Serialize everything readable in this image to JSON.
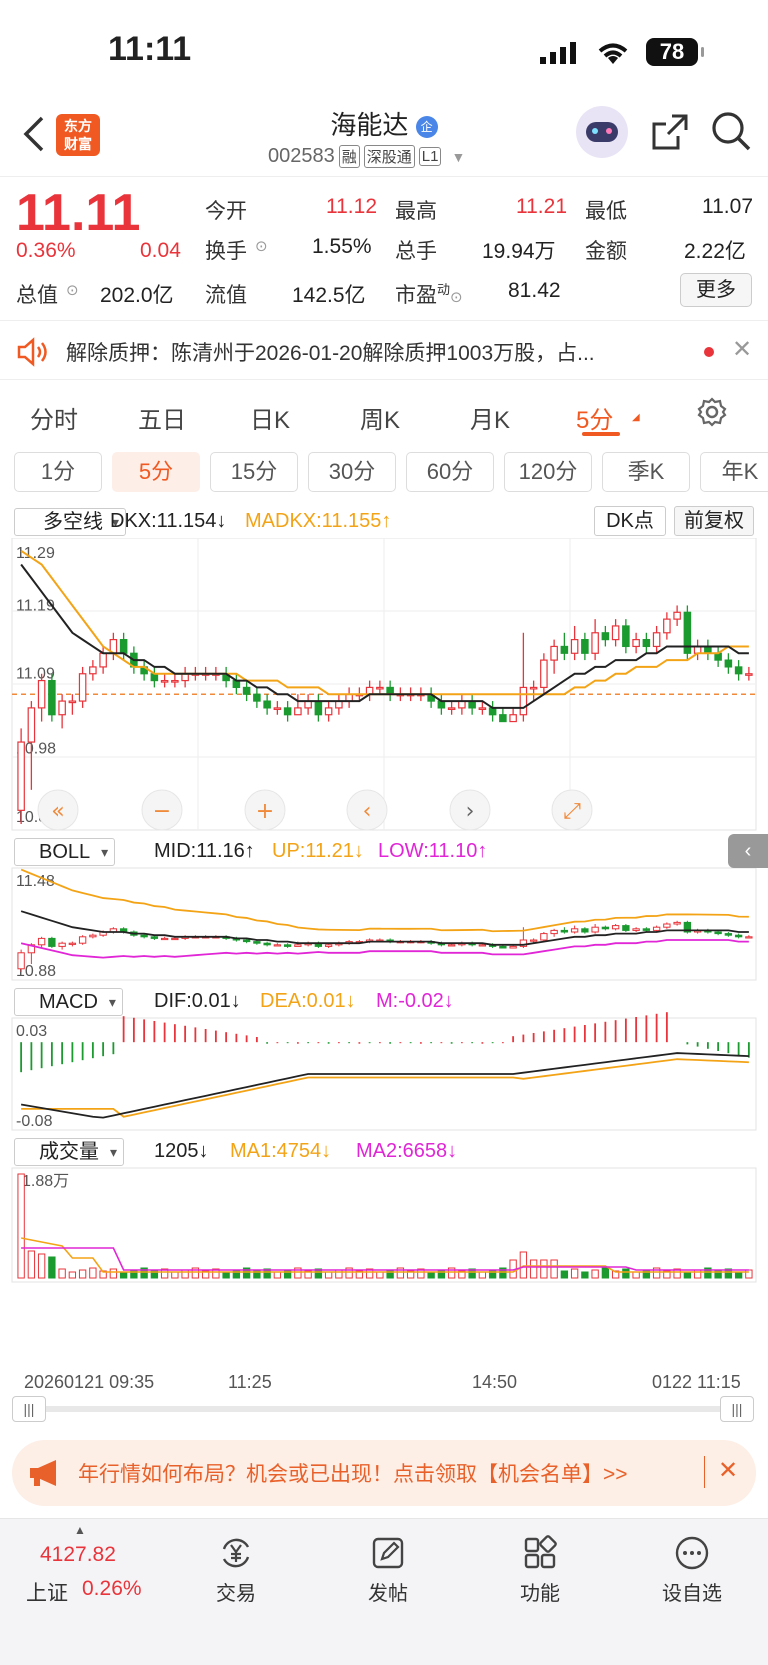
{
  "status_bar": {
    "time": "11:11",
    "battery": "78"
  },
  "header": {
    "title": "海能达",
    "title_badge": "企",
    "code": "002583",
    "tags": [
      "融",
      "深股通",
      "L1"
    ],
    "logo_line1": "东方",
    "logo_line2": "财富"
  },
  "quote": {
    "price": "11.11",
    "change_pct": "0.36%",
    "change": "0.04",
    "rows": [
      [
        {
          "label": "今开",
          "value": "11.12",
          "color": "red"
        },
        {
          "label": "最高",
          "value": "11.21",
          "color": "red"
        },
        {
          "label": "最低",
          "value": "11.07",
          "color": "black"
        }
      ],
      [
        {
          "label": "换手",
          "value": "1.55%",
          "color": "black"
        },
        {
          "label": "总手",
          "value": "19.94万",
          "color": "black"
        },
        {
          "label": "金额",
          "value": "2.22亿",
          "color": "black"
        }
      ],
      [
        {
          "label": "总值",
          "value": "202.0亿"
        },
        {
          "label": "流值",
          "value": "142.5亿"
        },
        {
          "label": "市盈",
          "sup": "动",
          "value": "81.42"
        }
      ]
    ],
    "more_label": "更多"
  },
  "news": {
    "text": "解除质押：陈清州于2026-01-20解除质押1003万股，占..."
  },
  "period_tabs": [
    "分时",
    "五日",
    "日K",
    "周K",
    "月K",
    "5分"
  ],
  "period_active": "5分",
  "minute_tabs": [
    "1分",
    "5分",
    "15分",
    "30分",
    "60分",
    "120分",
    "季K",
    "年K"
  ],
  "minute_active": "5分",
  "chart_data": {
    "type": "candlestick",
    "main": {
      "indicator": "多空线",
      "dkx_label": "DKX:11.154↓",
      "madkx_label": "MADKX:11.155↑",
      "dk_point": "DK点",
      "adjust": "前复权",
      "y_ticks": [
        "11.29",
        "11.19",
        "11.09",
        "10.98",
        "10.88"
      ],
      "ylim": [
        10.88,
        11.29
      ],
      "ref_line": 11.07,
      "candles": [
        [
          10.9,
          11.0,
          10.88,
          11.02
        ],
        [
          11.0,
          11.05,
          10.93,
          11.06
        ],
        [
          11.05,
          11.09,
          11.03,
          11.1
        ],
        [
          11.09,
          11.04,
          11.03,
          11.1
        ],
        [
          11.04,
          11.06,
          11.02,
          11.07
        ],
        [
          11.06,
          11.06,
          11.04,
          11.07
        ],
        [
          11.06,
          11.1,
          11.05,
          11.11
        ],
        [
          11.1,
          11.11,
          11.09,
          11.12
        ],
        [
          11.11,
          11.13,
          11.1,
          11.14
        ],
        [
          11.13,
          11.15,
          11.12,
          11.16
        ],
        [
          11.15,
          11.13,
          11.12,
          11.16
        ],
        [
          11.13,
          11.11,
          11.1,
          11.14
        ],
        [
          11.11,
          11.1,
          11.09,
          11.12
        ],
        [
          11.1,
          11.09,
          11.08,
          11.11
        ],
        [
          11.09,
          11.09,
          11.08,
          11.1
        ],
        [
          11.09,
          11.09,
          11.08,
          11.1
        ],
        [
          11.09,
          11.1,
          11.08,
          11.11
        ],
        [
          11.1,
          11.1,
          11.09,
          11.11
        ],
        [
          11.1,
          11.1,
          11.09,
          11.11
        ],
        [
          11.1,
          11.1,
          11.09,
          11.11
        ],
        [
          11.1,
          11.09,
          11.08,
          11.11
        ],
        [
          11.09,
          11.08,
          11.07,
          11.1
        ],
        [
          11.08,
          11.07,
          11.06,
          11.09
        ],
        [
          11.07,
          11.06,
          11.05,
          11.08
        ],
        [
          11.06,
          11.05,
          11.04,
          11.07
        ],
        [
          11.05,
          11.05,
          11.04,
          11.06
        ],
        [
          11.05,
          11.04,
          11.03,
          11.06
        ],
        [
          11.04,
          11.05,
          11.04,
          11.07
        ],
        [
          11.05,
          11.06,
          11.04,
          11.07
        ],
        [
          11.06,
          11.04,
          11.03,
          11.07
        ],
        [
          11.04,
          11.05,
          11.03,
          11.06
        ],
        [
          11.05,
          11.06,
          11.04,
          11.07
        ],
        [
          11.06,
          11.07,
          11.05,
          11.08
        ],
        [
          11.07,
          11.07,
          11.06,
          11.08
        ],
        [
          11.07,
          11.08,
          11.06,
          11.09
        ],
        [
          11.08,
          11.08,
          11.07,
          11.09
        ],
        [
          11.08,
          11.07,
          11.06,
          11.09
        ],
        [
          11.07,
          11.07,
          11.06,
          11.08
        ],
        [
          11.07,
          11.07,
          11.06,
          11.08
        ],
        [
          11.07,
          11.07,
          11.06,
          11.08
        ],
        [
          11.07,
          11.06,
          11.05,
          11.08
        ],
        [
          11.06,
          11.05,
          11.04,
          11.07
        ],
        [
          11.05,
          11.05,
          11.04,
          11.06
        ],
        [
          11.05,
          11.06,
          11.04,
          11.07
        ],
        [
          11.06,
          11.05,
          11.04,
          11.07
        ],
        [
          11.05,
          11.05,
          11.04,
          11.06
        ],
        [
          11.05,
          11.04,
          11.03,
          11.06
        ],
        [
          11.04,
          11.03,
          11.03,
          11.05
        ],
        [
          11.03,
          11.04,
          11.03,
          11.05
        ],
        [
          11.04,
          11.08,
          11.03,
          11.16
        ],
        [
          11.08,
          11.08,
          11.06,
          11.09
        ],
        [
          11.08,
          11.12,
          11.07,
          11.13
        ],
        [
          11.12,
          11.14,
          11.1,
          11.15
        ],
        [
          11.14,
          11.13,
          11.12,
          11.16
        ],
        [
          11.13,
          11.15,
          11.12,
          11.17
        ],
        [
          11.15,
          11.13,
          11.12,
          11.16
        ],
        [
          11.13,
          11.16,
          11.12,
          11.18
        ],
        [
          11.16,
          11.15,
          11.14,
          11.17
        ],
        [
          11.15,
          11.17,
          11.14,
          11.18
        ],
        [
          11.17,
          11.14,
          11.13,
          11.18
        ],
        [
          11.14,
          11.15,
          11.13,
          11.16
        ],
        [
          11.15,
          11.14,
          11.13,
          11.16
        ],
        [
          11.14,
          11.16,
          11.13,
          11.17
        ],
        [
          11.16,
          11.18,
          11.15,
          11.19
        ],
        [
          11.18,
          11.19,
          11.17,
          11.2
        ],
        [
          11.19,
          11.13,
          11.12,
          11.2
        ],
        [
          11.13,
          11.14,
          11.12,
          11.15
        ],
        [
          11.14,
          11.13,
          11.12,
          11.15
        ],
        [
          11.13,
          11.12,
          11.11,
          11.14
        ],
        [
          11.12,
          11.11,
          11.1,
          11.13
        ],
        [
          11.11,
          11.1,
          11.09,
          11.12
        ],
        [
          11.1,
          11.1,
          11.09,
          11.11
        ]
      ],
      "dkx": [
        11.26,
        11.24,
        11.22,
        11.2,
        11.18,
        11.16,
        11.15,
        11.14,
        11.13,
        11.13,
        11.13,
        11.12,
        11.12,
        11.11,
        11.11,
        11.1,
        11.1,
        11.1,
        11.1,
        11.1,
        11.1,
        11.09,
        11.09,
        11.08,
        11.08,
        11.07,
        11.07,
        11.06,
        11.06,
        11.06,
        11.06,
        11.06,
        11.06,
        11.06,
        11.07,
        11.07,
        11.07,
        11.07,
        11.07,
        11.07,
        11.07,
        11.06,
        11.06,
        11.06,
        11.06,
        11.06,
        11.05,
        11.05,
        11.05,
        11.05,
        11.06,
        11.07,
        11.08,
        11.09,
        11.1,
        11.1,
        11.11,
        11.11,
        11.12,
        11.12,
        11.12,
        11.13,
        11.13,
        11.14,
        11.14,
        11.14,
        11.14,
        11.14,
        11.14,
        11.14,
        11.13,
        11.13
      ],
      "madkx": [
        11.28,
        11.27,
        11.26,
        11.24,
        11.22,
        11.2,
        11.18,
        11.16,
        11.14,
        11.13,
        11.12,
        11.11,
        11.11,
        11.1,
        11.1,
        11.1,
        11.1,
        11.1,
        11.1,
        11.1,
        11.1,
        11.1,
        11.09,
        11.09,
        11.09,
        11.09,
        11.08,
        11.08,
        11.08,
        11.08,
        11.07,
        11.07,
        11.07,
        11.07,
        11.07,
        11.07,
        11.07,
        11.07,
        11.07,
        11.07,
        11.07,
        11.07,
        11.07,
        11.07,
        11.07,
        11.07,
        11.07,
        11.07,
        11.07,
        11.07,
        11.07,
        11.07,
        11.07,
        11.07,
        11.08,
        11.08,
        11.09,
        11.09,
        11.1,
        11.1,
        11.11,
        11.11,
        11.11,
        11.12,
        11.12,
        11.12,
        11.13,
        11.13,
        11.13,
        11.14,
        11.14,
        11.14
      ]
    },
    "boll": {
      "indicator": "BOLL",
      "mid_label": "MID:11.16↑",
      "up_label": "UP:11.21↓",
      "low_label": "LOW:11.10↑",
      "y_ticks": [
        "11.48",
        "10.88"
      ]
    },
    "macd": {
      "indicator": "MACD",
      "dif_label": "DIF:0.01↓",
      "dea_label": "DEA:0.01↓",
      "m_label": "M:-0.02↓",
      "y_ticks": [
        "0.03",
        "-0.08"
      ],
      "ylim": [
        -0.08,
        0.03
      ]
    },
    "volume": {
      "indicator": "成交量",
      "vol_label": "1205↓",
      "ma1_label": "MA1:4754↓",
      "ma2_label": "MA2:6658↓",
      "y_ticks": [
        "1.88万"
      ],
      "x_ticks": [
        "20260121 09:35",
        "11:25",
        "14:50",
        "0122 11:15"
      ]
    }
  },
  "ad": {
    "text": "年行情如何布局？机会或已出现！点击领取【机会名单】>>"
  },
  "bottom": {
    "index_value": "4127.82",
    "index_name": "上证",
    "index_change": "0.26%",
    "buttons": [
      "交易",
      "发帖",
      "功能",
      "设自选"
    ]
  },
  "colors": {
    "up": "#e8343a",
    "down": "#1a9a2f",
    "accent": "#f05a22",
    "dkx": "#222222",
    "madkx": "#f3a316",
    "low": "#e026d6"
  }
}
